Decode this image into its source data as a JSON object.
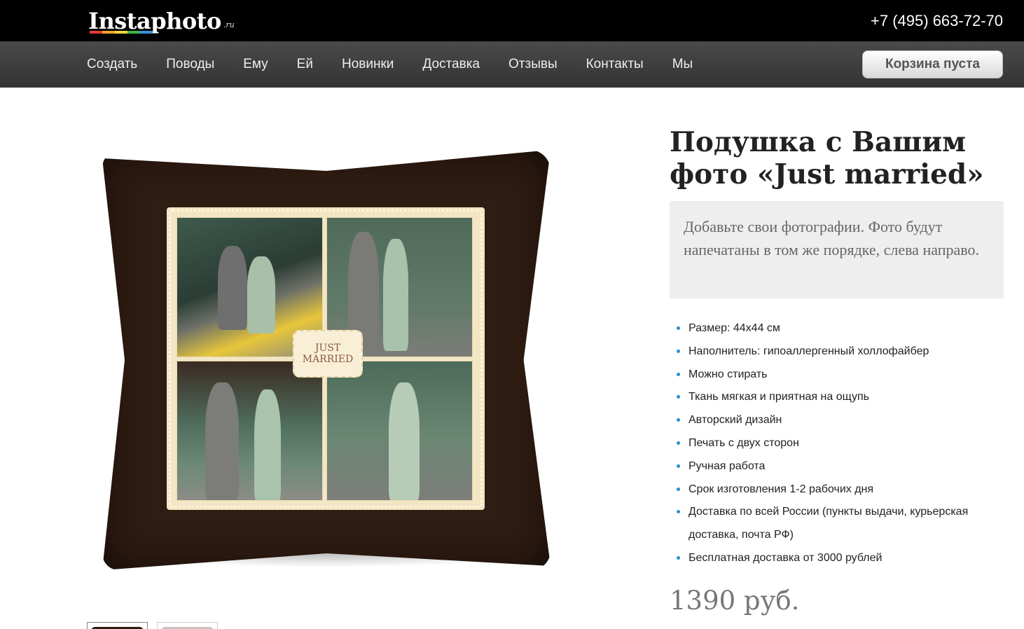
{
  "header": {
    "logo_text": "Instaphoto",
    "logo_suffix": ".ru",
    "logo_colors": [
      "#e23b3b",
      "#f1a22a",
      "#f2d33b",
      "#3fb54a",
      "#3a8fd9"
    ],
    "phone": "+7 (495) 663-72-70"
  },
  "nav": {
    "items": [
      "Создать",
      "Поводы",
      "Ему",
      "Ей",
      "Новинки",
      "Доставка",
      "Отзывы",
      "Контакты",
      "Мы"
    ],
    "cart_label": "Корзина пуста"
  },
  "product": {
    "title": "Подушка с Вашим фото «Just married»",
    "notice": "Добавьте свои фотографии. Фото будут напечатаны в том же порядке, слева направо.",
    "badge_line1": "JUST",
    "badge_line2": "MARRIED",
    "features": [
      "Размер: 44х44 см",
      "Наполнитель: гипоаллергенный холлофайбер",
      "Можно стирать",
      "Ткань мягкая и приятная на ощупь",
      "Авторский дизайн",
      "Печать с двух сторон",
      "Ручная работа",
      "Срок изготовления 1-2 рабочих дня",
      "Доставка по всей России (пункты выдачи, курьерская доставка, почта РФ)",
      "Бесплатная доставка от 3000 рублей"
    ],
    "price": "1390 руб.",
    "bullet_color": "#2a8fd6"
  }
}
